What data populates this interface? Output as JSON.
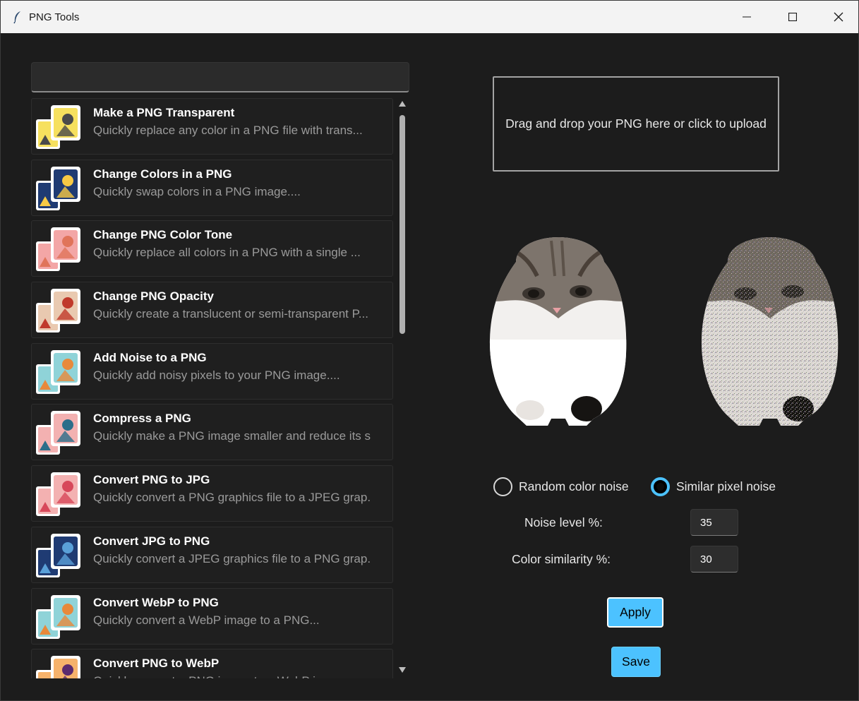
{
  "window": {
    "title": "PNG Tools",
    "controls": {
      "minimize": "minimize",
      "maximize": "maximize",
      "close": "close"
    }
  },
  "search": {
    "value": "",
    "placeholder": ""
  },
  "tools": [
    {
      "title": "Make a PNG Transparent",
      "desc": "Quickly replace any color in a PNG file with trans...",
      "icon": "palm-tree-icon",
      "colors": [
        "#f6e05e",
        "#4a4a4a"
      ]
    },
    {
      "title": "Change Colors in a PNG",
      "desc": "Quickly swap colors in a PNG image....",
      "icon": "night-hills-icon",
      "colors": [
        "#1f3b73",
        "#f6c945"
      ]
    },
    {
      "title": "Change PNG Color Tone",
      "desc": "Quickly replace all colors in a PNG with a single ...",
      "icon": "cat-icon",
      "colors": [
        "#f3a6a6",
        "#e0745a"
      ]
    },
    {
      "title": "Change PNG Opacity",
      "desc": "Quickly create a translucent or semi-transparent P...",
      "icon": "house-icon",
      "colors": [
        "#e9c9b0",
        "#c0392b"
      ]
    },
    {
      "title": "Add Noise to a PNG",
      "desc": "Quickly add noisy pixels to your PNG image....",
      "icon": "flower-icon",
      "colors": [
        "#8fd3d8",
        "#e8893b"
      ]
    },
    {
      "title": "Compress a PNG",
      "desc": "Quickly make a PNG image smaller and reduce its s",
      "icon": "compress-icon",
      "colors": [
        "#f3b1b1",
        "#2b6e8a"
      ]
    },
    {
      "title": "Convert PNG to JPG",
      "desc": "Quickly convert a PNG graphics file to a JPEG grap.",
      "icon": "mountain-icon",
      "colors": [
        "#f3b1b1",
        "#d7485a"
      ]
    },
    {
      "title": "Convert JPG to PNG",
      "desc": "Quickly convert a JPEG graphics file to a PNG grap.",
      "icon": "night-hills-icon",
      "colors": [
        "#1f3b73",
        "#5aa0d8"
      ]
    },
    {
      "title": "Convert WebP to PNG",
      "desc": "Quickly convert a WebP image to a PNG...",
      "icon": "flower-icon",
      "colors": [
        "#8fd3d8",
        "#e8893b"
      ]
    },
    {
      "title": "Convert PNG to WebP",
      "desc": "Quickly convert a PNG image to a WebP image...",
      "icon": "cat-icon",
      "colors": [
        "#f6b26b",
        "#5b2a6e"
      ]
    }
  ],
  "dropzone": {
    "text": "Drag and drop your PNG here or click to upload"
  },
  "preview": {
    "original": "cat-original-image",
    "noisy": "cat-noisy-image"
  },
  "options": {
    "random_label": "Random color noise",
    "similar_label": "Similar pixel noise",
    "selected": "similar"
  },
  "fields": {
    "noise_label": "Noise level %:",
    "noise_value": "35",
    "similarity_label": "Color similarity %:",
    "similarity_value": "30"
  },
  "buttons": {
    "apply": "Apply",
    "save": "Save"
  },
  "colors": {
    "accent": "#4cc2ff",
    "background": "#1c1c1c",
    "titlebar": "#f3f3f3"
  }
}
